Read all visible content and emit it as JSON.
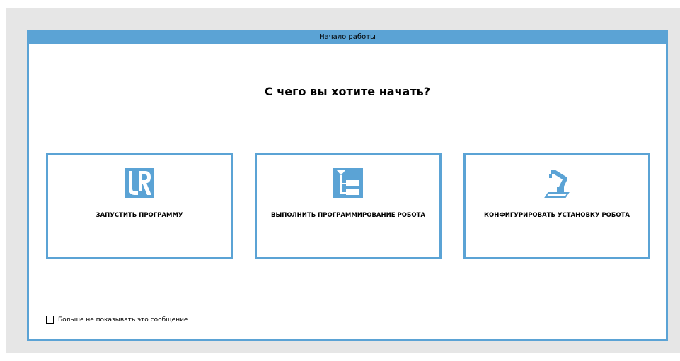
{
  "dialog": {
    "title": "Начало работы",
    "headline": "С чего вы хотите начать?"
  },
  "cards": [
    {
      "label": "ЗАПУСТИТЬ ПРОГРАММУ",
      "icon": "ur-logo-icon"
    },
    {
      "label": "ВЫПОЛНИТЬ ПРОГРАММИРОВАНИЕ РОБОТА",
      "icon": "program-tree-icon"
    },
    {
      "label": "КОНФИГУРИРОВАТЬ УСТАНОВКУ РОБОТА",
      "icon": "robot-arm-icon"
    }
  ],
  "footer": {
    "dont_show_label": "Больше не показывать это сообщение",
    "dont_show_checked": false
  },
  "colors": {
    "accent": "#5ba3d5",
    "backdrop": "#e6e6e6"
  }
}
